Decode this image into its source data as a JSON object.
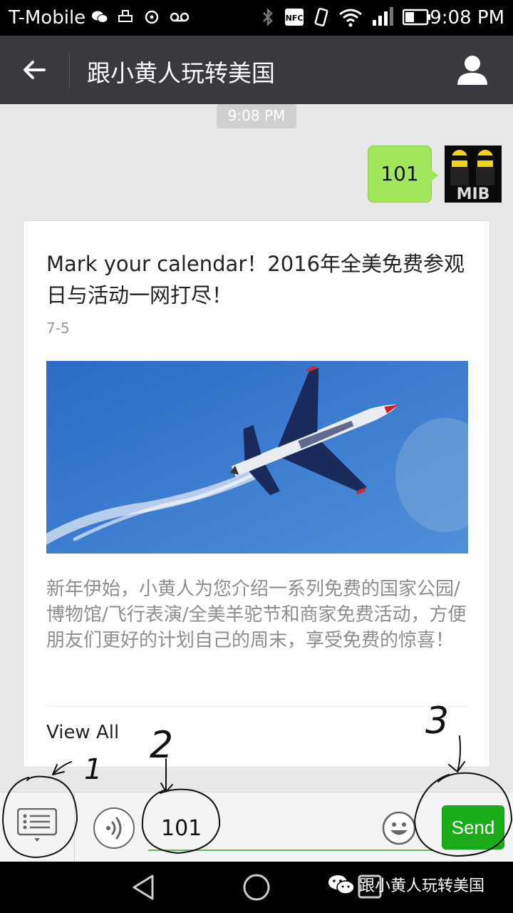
{
  "status_bar": {
    "carrier": "T-Mobile",
    "time": "9:08 PM",
    "icons": [
      "wechat-icon",
      "print-icon",
      "sync-icon",
      "voicemail-icon",
      "bluetooth-icon",
      "nfc-icon",
      "vibrate-icon",
      "wifi-icon",
      "signal-icon",
      "battery-icon"
    ]
  },
  "header": {
    "title": "跟小黄人玩转美国",
    "back_icon": "arrow-left-icon",
    "profile_icon": "person-icon"
  },
  "chat": {
    "timestamp": "9:08 PM",
    "sent_message": "101",
    "avatar_text": "MIB",
    "article": {
      "title": "Mark your calendar！2016年全美免费参观日与活动一网打尽！",
      "date": "7-5",
      "image": "fighter-jet-photo",
      "description": "新年伊始，小黄人为您介绍一系列免费的国家公园/博物馆/飞行表演/全美羊驼节和商家免费活动，方便朋友们更好的计划自己的周末，享受免费的惊喜！",
      "view_all": "View All"
    }
  },
  "input_bar": {
    "text_value": "101",
    "send_label": "Send",
    "menu_icon": "list-menu-icon",
    "voice_icon": "voice-icon",
    "emoji_icon": "emoji-icon"
  },
  "annotations": [
    "1",
    "2",
    "3"
  ],
  "watermark": {
    "text": "跟小黄人玩转美国"
  },
  "colors": {
    "title_bar": "#393a3f",
    "bubble": "#a0e75a",
    "send_button": "#1aad19",
    "chat_background": "#e8e8e8"
  }
}
